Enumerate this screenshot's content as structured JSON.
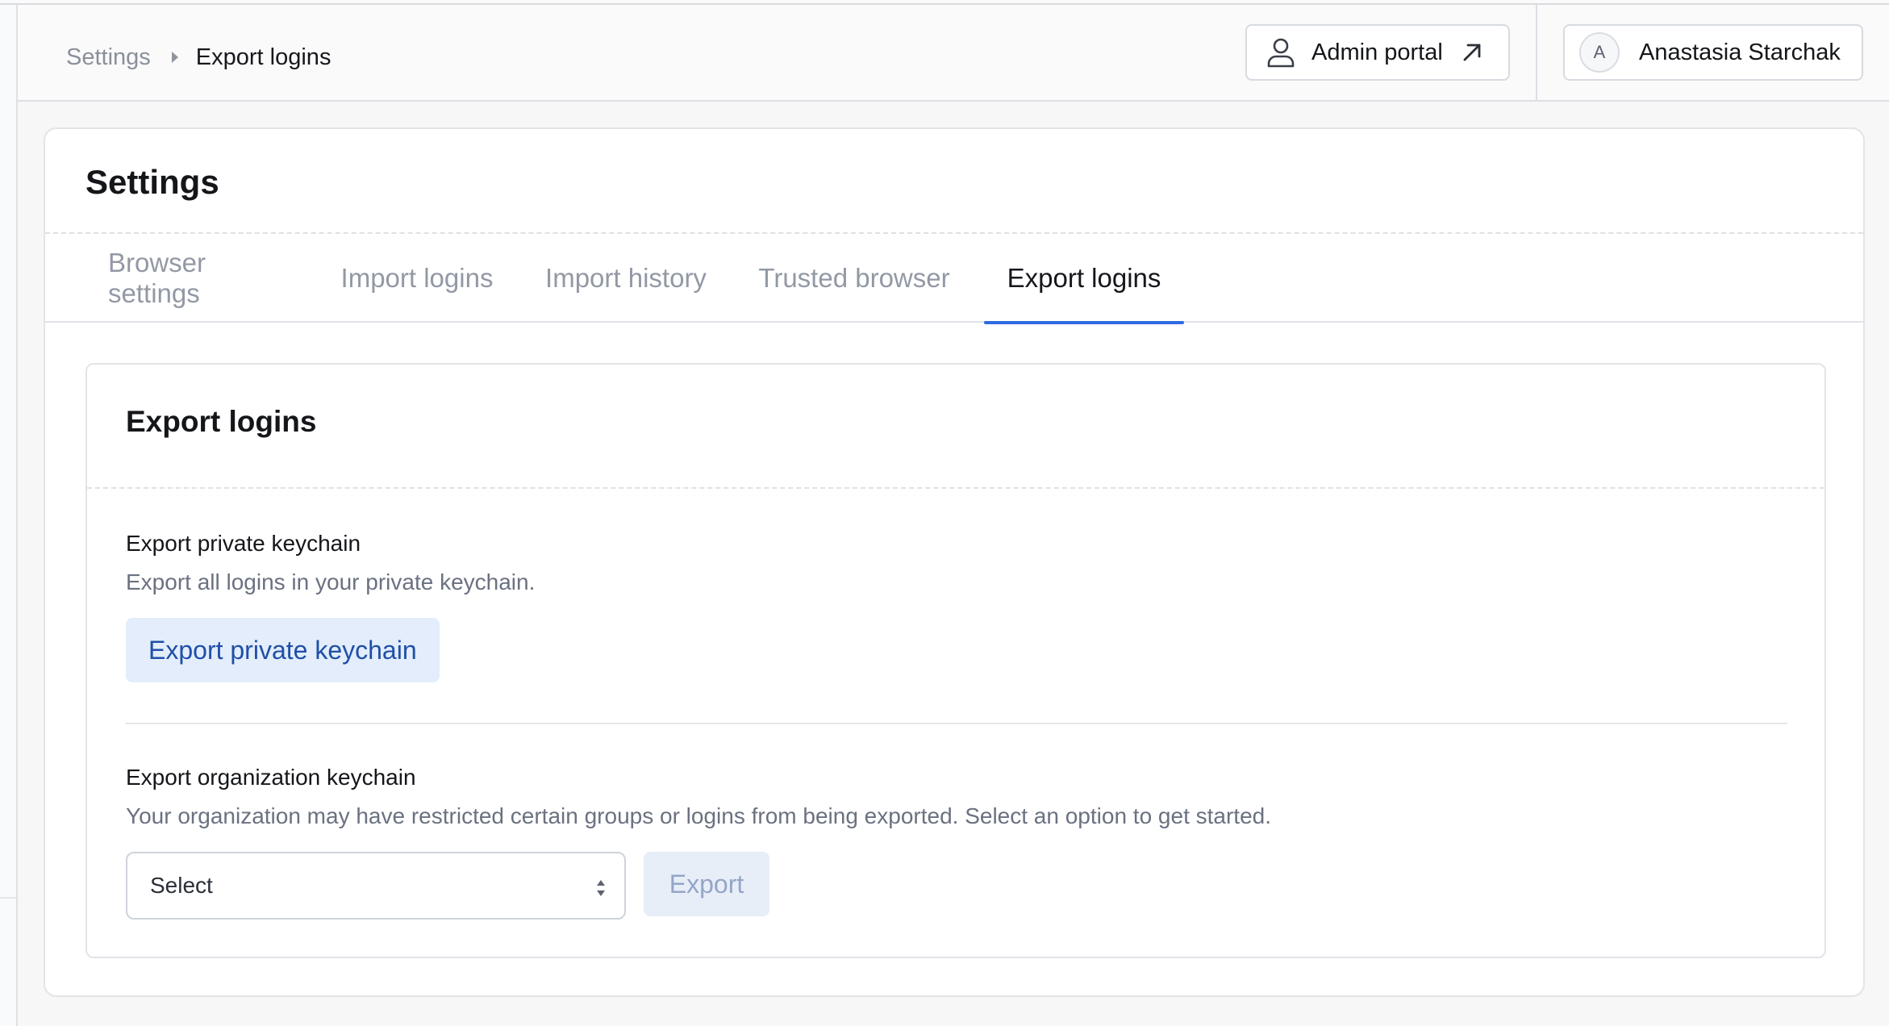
{
  "breadcrumb": {
    "parent": "Settings",
    "current": "Export logins"
  },
  "header": {
    "admin_portal_label": "Admin portal",
    "user_initial": "A",
    "user_name": "Anastasia Starchak"
  },
  "settings": {
    "title": "Settings",
    "tabs": [
      {
        "label": "Browser settings",
        "active": false
      },
      {
        "label": "Import logins",
        "active": false
      },
      {
        "label": "Import history",
        "active": false
      },
      {
        "label": "Trusted browser",
        "active": false
      },
      {
        "label": "Export logins",
        "active": true
      }
    ]
  },
  "export": {
    "title": "Export logins",
    "private": {
      "title": "Export private keychain",
      "description": "Export all logins in your private keychain.",
      "button_label": "Export private keychain"
    },
    "organization": {
      "title": "Export organization keychain",
      "description": "Your organization may have restricted certain groups or logins from being exported. Select an option to get started.",
      "select_value": "Select",
      "export_button_label": "Export"
    }
  },
  "colors": {
    "accent": "#2f6ce0",
    "primary_soft_bg": "#e3edfb",
    "primary_soft_text": "#1f4fa8",
    "disabled_text": "#93a6c8"
  },
  "icons": {
    "admin_portal": "person-icon",
    "admin_portal_external": "arrow-up-right-icon",
    "breadcrumb_separator": "caret-right-icon",
    "select_toggle": "chevron-up-down-icon"
  }
}
